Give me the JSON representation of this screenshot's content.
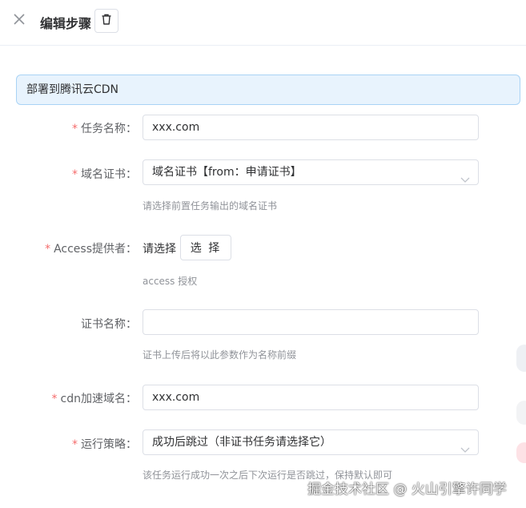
{
  "header": {
    "title": "编辑步骤"
  },
  "banner": {
    "text": "部署到腾讯云CDN"
  },
  "form": {
    "task_name": {
      "label": "任务名称：",
      "required": "*",
      "value": "xxx.com"
    },
    "cert": {
      "label": "域名证书：",
      "required": "*",
      "value": "域名证书【from：申请证书】",
      "help": "请选择前置任务输出的域名证书"
    },
    "access": {
      "label": "Access提供者：",
      "required": "*",
      "value": "请选择",
      "button": "选 择",
      "help": "access 授权"
    },
    "cert_name": {
      "label": "证书名称：",
      "value": "",
      "help": "证书上传后将以此参数作为名称前缀"
    },
    "cdn_domain": {
      "label": "cdn加速域名：",
      "required": "*",
      "value": "xxx.com"
    },
    "strategy": {
      "label": "运行策略：",
      "required": "*",
      "value": "成功后跳过（非证书任务请选择它）",
      "help": "该任务运行成功一次之后下次运行是否跳过，保持默认即可"
    }
  },
  "watermark": "掘金技术社区 @ 火山引擎许同学",
  "colors": {
    "required": "#f56c6c",
    "banner_bg": "#e8f3fd",
    "banner_border": "#a9d3f5"
  }
}
